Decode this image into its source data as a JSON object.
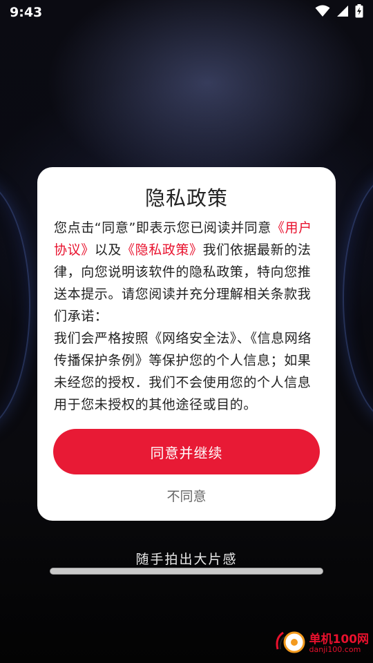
{
  "status_bar": {
    "time": "9:43",
    "icons": [
      "wifi-icon",
      "signal-icon",
      "battery-charging-icon"
    ]
  },
  "dialog": {
    "title": "隐私政策",
    "body": {
      "p1_a": "您点击“同意”即表示您已阅读并同意",
      "link_user": "《用户协议》",
      "p1_b": "以及",
      "link_privacy": "《隐私政策》",
      "p1_c": "我们依据最新的法律，向您说明该软件的隐私政策，特向您推送本提示。请您阅读并充分理解相关条款我们承诺：",
      "p2": "我们会严格按照《网络安全法》、《信息网络传播保护条例》等保护您的个人信息；如果未经您的授权．我们不会使用您的个人信息用于您未授权的其他途径或目的。"
    },
    "agree_label": "同意并继续",
    "disagree_label": "不同意"
  },
  "splash": {
    "slogan": "随手拍出大片感",
    "progress": 1.0
  },
  "watermark": {
    "text_cn": "单机100网",
    "text_en": "danji100.com"
  },
  "colors": {
    "accent": "#e81a35",
    "link": "#e8112d"
  }
}
